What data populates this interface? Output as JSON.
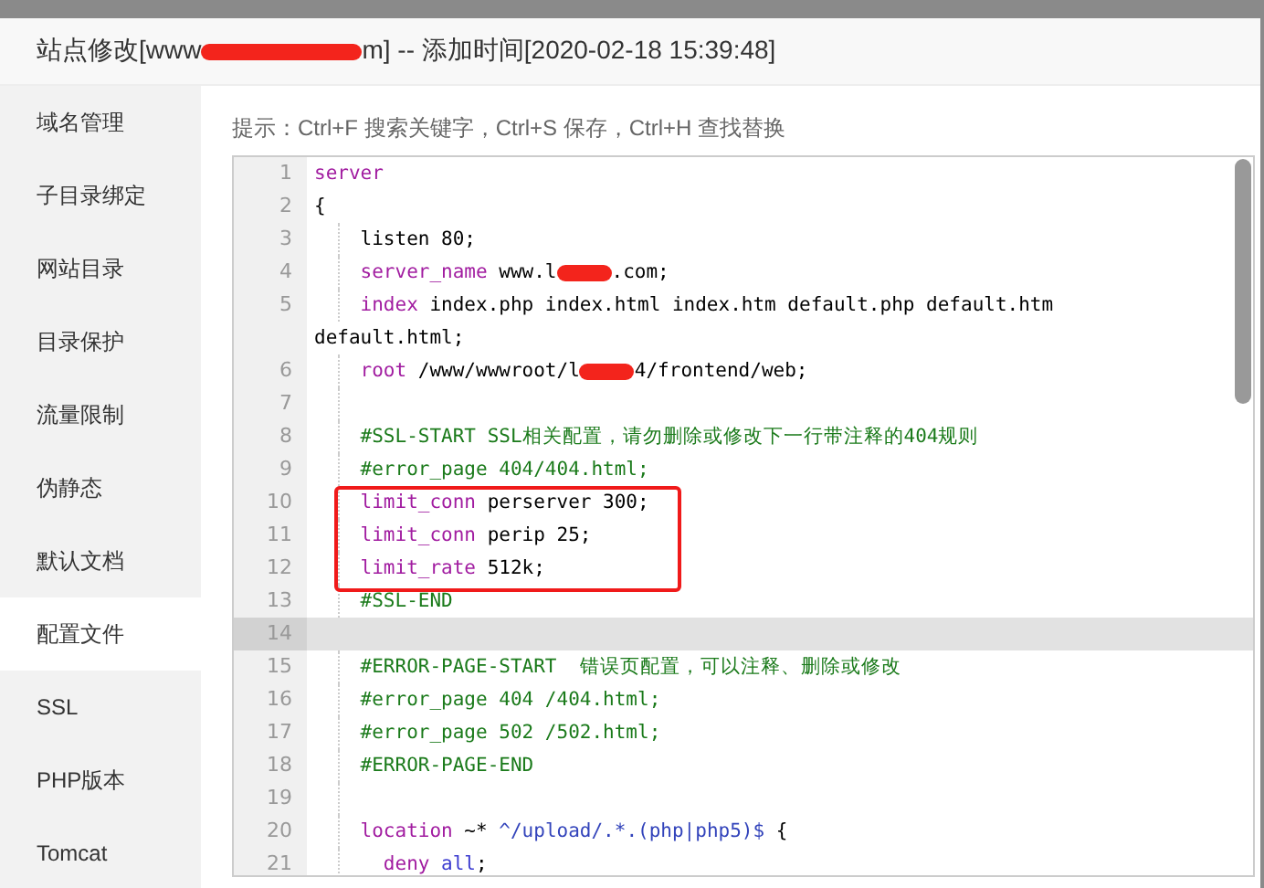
{
  "window": {
    "title": [
      {
        "kind": "text",
        "text": "站点修改[www"
      },
      {
        "kind": "redacted"
      },
      {
        "kind": "text",
        "text": "m] -- 添加时间[2020-02-18 15:39:48]"
      }
    ]
  },
  "sidebar": {
    "items": [
      {
        "label": "域名管理",
        "selected": false
      },
      {
        "label": "子目录绑定",
        "selected": false
      },
      {
        "label": "网站目录",
        "selected": false
      },
      {
        "label": "目录保护",
        "selected": false
      },
      {
        "label": "流量限制",
        "selected": false
      },
      {
        "label": "伪静态",
        "selected": false
      },
      {
        "label": "默认文档",
        "selected": false
      },
      {
        "label": "配置文件",
        "selected": true
      },
      {
        "label": "SSL",
        "selected": false
      },
      {
        "label": "PHP版本",
        "selected": false
      },
      {
        "label": "Tomcat",
        "selected": false
      }
    ]
  },
  "hint": "提示：Ctrl+F 搜索关键字，Ctrl+S 保存，Ctrl+H 查找替换",
  "editor": {
    "lines": [
      {
        "number": "1",
        "active": false,
        "boxed": false,
        "tokens": [
          {
            "kind": "keyword",
            "text": "server"
          }
        ]
      },
      {
        "number": "2",
        "active": false,
        "boxed": false,
        "tokens": [
          {
            "kind": "plain",
            "text": "{"
          }
        ]
      },
      {
        "number": "3",
        "active": false,
        "boxed": false,
        "tokens": [
          {
            "kind": "indent"
          },
          {
            "kind": "plain",
            "text": "listen 80;"
          }
        ]
      },
      {
        "number": "4",
        "active": false,
        "boxed": false,
        "tokens": [
          {
            "kind": "indent"
          },
          {
            "kind": "keyword",
            "text": "server_name"
          },
          {
            "kind": "plain",
            "text": " www.l"
          },
          {
            "kind": "redacted"
          },
          {
            "kind": "plain",
            "text": ".com;"
          }
        ]
      },
      {
        "number": "5",
        "active": false,
        "boxed": false,
        "tokens": [
          {
            "kind": "indent"
          },
          {
            "kind": "keyword",
            "text": "index"
          },
          {
            "kind": "plain",
            "text": " index.php index.html index.htm default.php default.htm default.html;"
          }
        ]
      },
      {
        "number": "6",
        "active": false,
        "boxed": false,
        "tokens": [
          {
            "kind": "indent"
          },
          {
            "kind": "keyword",
            "text": "root"
          },
          {
            "kind": "plain",
            "text": " /www/wwwroot/l"
          },
          {
            "kind": "redacted"
          },
          {
            "kind": "plain",
            "text": "4/frontend/web;"
          }
        ]
      },
      {
        "number": "7",
        "active": false,
        "boxed": false,
        "tokens": [
          {
            "kind": "indent"
          }
        ]
      },
      {
        "number": "8",
        "active": false,
        "boxed": false,
        "tokens": [
          {
            "kind": "indent"
          },
          {
            "kind": "comment",
            "text": "#SSL-START SSL相关配置，请勿删除或修改下一行带注释的404规则"
          }
        ]
      },
      {
        "number": "9",
        "active": false,
        "boxed": false,
        "tokens": [
          {
            "kind": "indent"
          },
          {
            "kind": "comment",
            "text": "#error_page 404/404.html;"
          }
        ]
      },
      {
        "number": "10",
        "active": false,
        "boxed": true,
        "tokens": [
          {
            "kind": "indent"
          },
          {
            "kind": "keyword",
            "text": "limit_conn"
          },
          {
            "kind": "plain",
            "text": " perserver 300;"
          }
        ]
      },
      {
        "number": "11",
        "active": false,
        "boxed": true,
        "tokens": [
          {
            "kind": "indent"
          },
          {
            "kind": "keyword",
            "text": "limit_conn"
          },
          {
            "kind": "plain",
            "text": " perip 25;"
          }
        ]
      },
      {
        "number": "12",
        "active": false,
        "boxed": true,
        "tokens": [
          {
            "kind": "indent"
          },
          {
            "kind": "keyword",
            "text": "limit_rate"
          },
          {
            "kind": "plain",
            "text": " 512k;"
          }
        ]
      },
      {
        "number": "13",
        "active": false,
        "boxed": false,
        "tokens": [
          {
            "kind": "indent"
          },
          {
            "kind": "comment",
            "text": "#SSL-END"
          }
        ]
      },
      {
        "number": "14",
        "active": true,
        "boxed": false
      },
      {
        "number": "15",
        "active": false,
        "boxed": false,
        "tokens": [
          {
            "kind": "indent"
          },
          {
            "kind": "comment",
            "text": "#ERROR-PAGE-START  错误页配置，可以注释、删除或修改"
          }
        ]
      },
      {
        "number": "16",
        "active": false,
        "boxed": false,
        "tokens": [
          {
            "kind": "indent"
          },
          {
            "kind": "comment",
            "text": "#error_page 404 /404.html;"
          }
        ]
      },
      {
        "number": "17",
        "active": false,
        "boxed": false,
        "tokens": [
          {
            "kind": "indent"
          },
          {
            "kind": "comment",
            "text": "#error_page 502 /502.html;"
          }
        ]
      },
      {
        "number": "18",
        "active": false,
        "boxed": false,
        "tokens": [
          {
            "kind": "indent"
          },
          {
            "kind": "comment",
            "text": "#ERROR-PAGE-END"
          }
        ]
      },
      {
        "number": "19",
        "active": false,
        "boxed": false,
        "tokens": [
          {
            "kind": "indent"
          }
        ]
      },
      {
        "number": "20",
        "active": false,
        "boxed": false,
        "tokens": [
          {
            "kind": "indent"
          },
          {
            "kind": "keyword",
            "text": "location"
          },
          {
            "kind": "plain",
            "text": " ~* "
          },
          {
            "kind": "string",
            "text": "^/upload/.*.(php|php5)$"
          },
          {
            "kind": "plain",
            "text": " {"
          }
        ]
      },
      {
        "number": "21",
        "active": false,
        "boxed": false,
        "tokens": [
          {
            "kind": "indent"
          },
          {
            "kind": "pad"
          },
          {
            "kind": "keyword",
            "text": "deny"
          },
          {
            "kind": "atom",
            "text": " all"
          },
          {
            "kind": "plain",
            "text": ";"
          }
        ]
      }
    ]
  }
}
